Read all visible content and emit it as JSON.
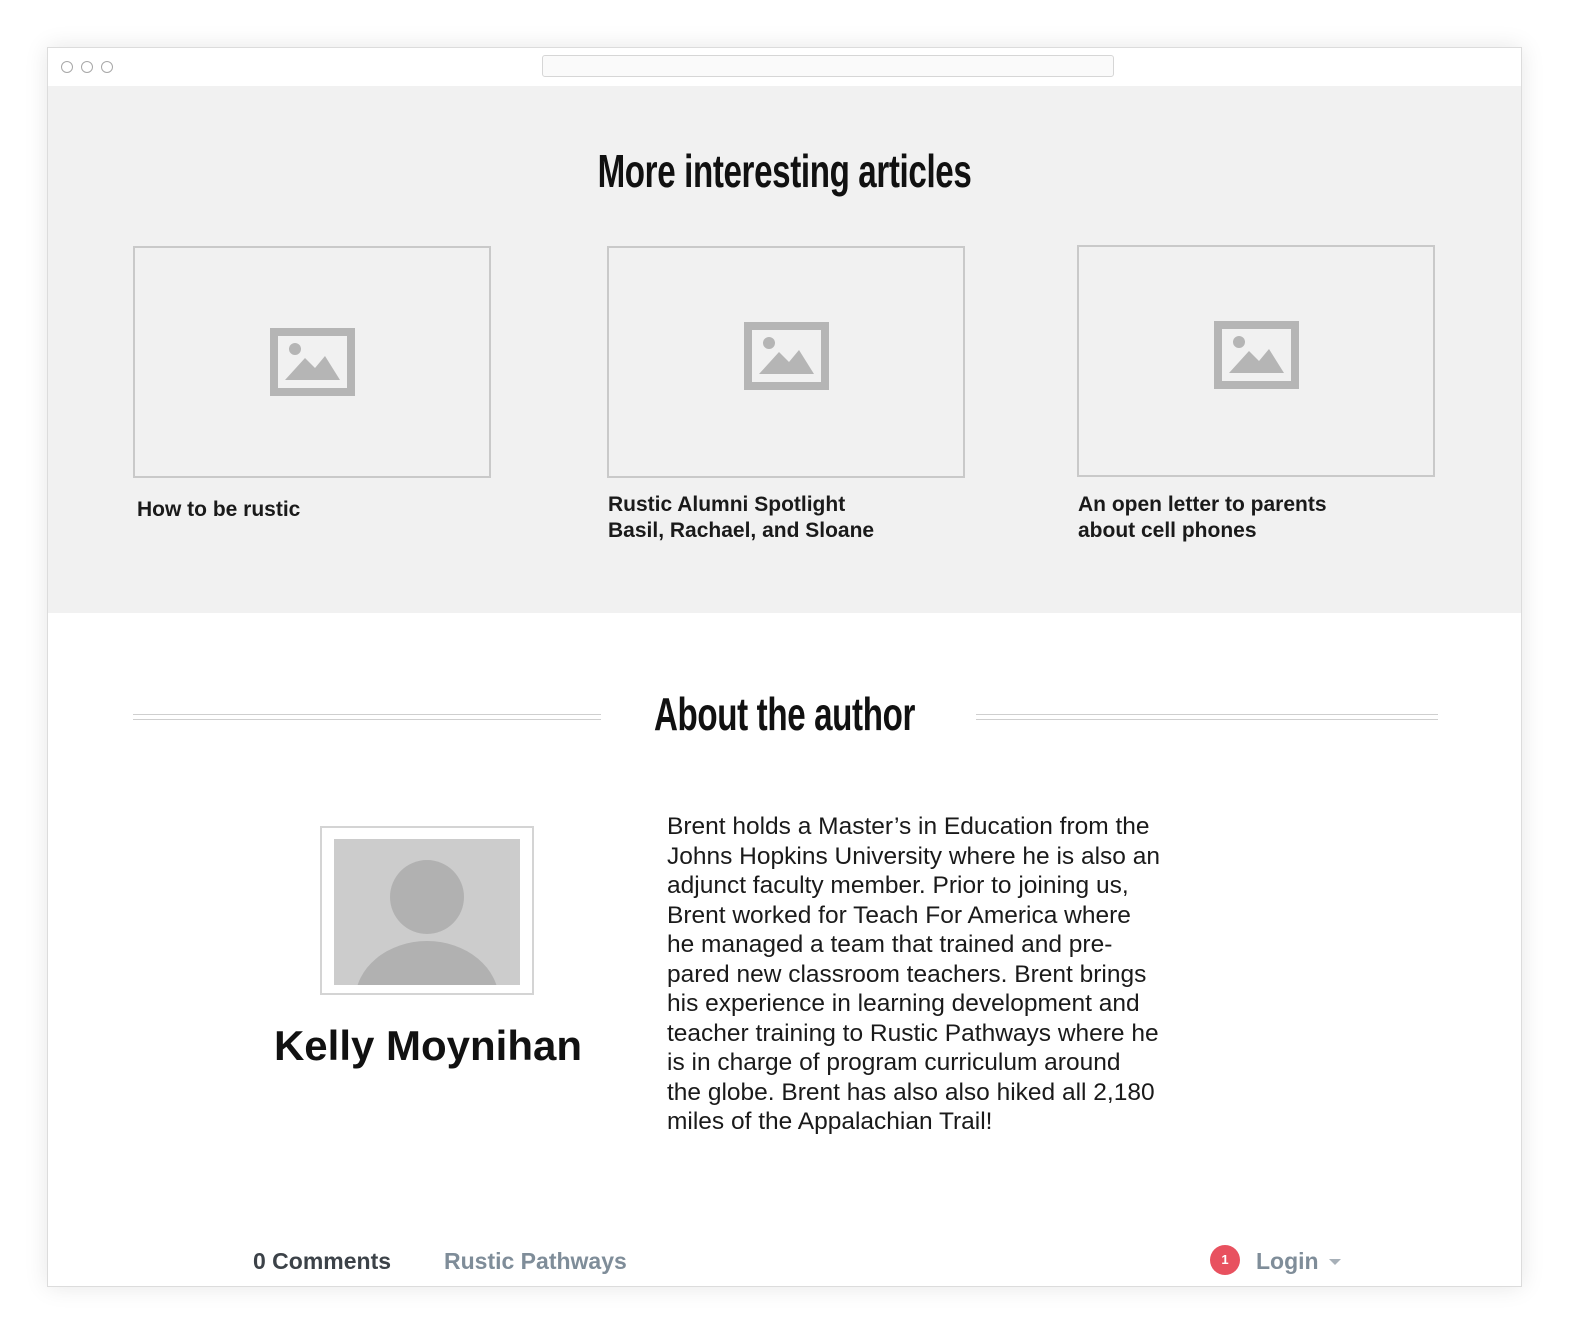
{
  "more_section": {
    "title": "More interesting articles",
    "articles": [
      {
        "title": "How to be rustic"
      },
      {
        "title": "Rustic Alumni Spotlight\nBasil, Rachael, and Sloane"
      },
      {
        "title": "An open letter to parents\nabout cell phones"
      }
    ]
  },
  "about_section": {
    "title": "About the author",
    "author_name": "Kelly Moynihan",
    "bio": "Brent holds a Master’s in Education from the\nJohns Hopkins University where he is also an\nadjunct faculty member. Prior to joining us,\nBrent worked for Teach For America where\nhe managed a team that trained and pre-\npared new classroom teachers. Brent brings\nhis experience in learning development and\nteacher training to Rustic Pathways where he\nis in charge of program curriculum around\nthe globe. Brent has also also hiked all 2,180\nmiles of the Appalachian Trail!"
  },
  "comments_bar": {
    "comments_count_label": "0 Comments",
    "community_label": "Rustic Pathways",
    "notification_count": "1",
    "login_label": "Login"
  },
  "colors": {
    "section_bg": "#f1f1f1",
    "placeholder_gray": "#b5b5b5",
    "badge_red": "#e8515f",
    "muted_text": "#7f8d99"
  },
  "icons": {
    "article_image": "image-placeholder-icon",
    "avatar": "person-placeholder-icon",
    "login_dropdown": "chevron-down-icon"
  }
}
